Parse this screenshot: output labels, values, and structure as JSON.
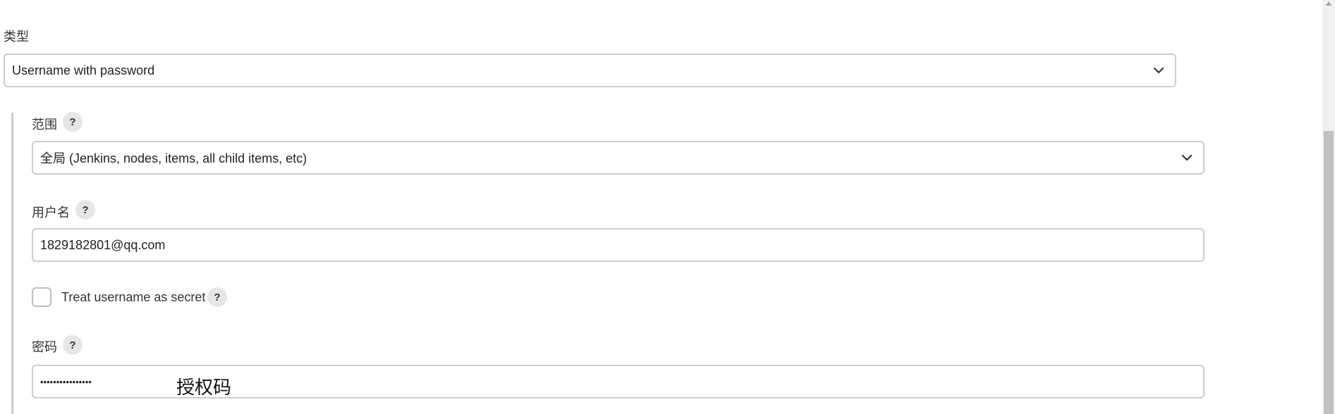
{
  "type_section": {
    "label": "类型",
    "select_value": "Username with password"
  },
  "scope": {
    "label": "范围",
    "help": "?",
    "select_value": "全局 (Jenkins, nodes, items, all child items, etc)"
  },
  "username": {
    "label": "用户名",
    "help": "?",
    "value": "1829182801@qq.com"
  },
  "treat_secret": {
    "label": "Treat username as secret",
    "help": "?",
    "checked": false
  },
  "password": {
    "label": "密码",
    "help": "?",
    "masked_value": "••••••••••••••••",
    "annotation": "授权码"
  }
}
